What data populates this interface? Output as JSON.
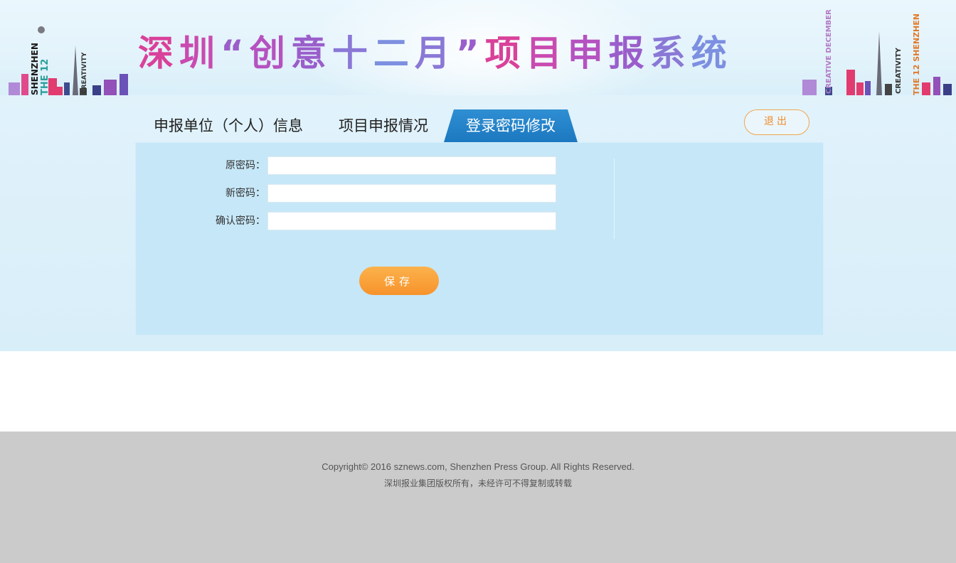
{
  "banner": {
    "title_chars": [
      "深",
      "圳",
      "“",
      "创",
      "意",
      "十",
      "二",
      "月",
      "”",
      "项",
      "目",
      "申",
      "报",
      "系",
      "统"
    ],
    "title_colors": [
      "#d9419a",
      "#c94bb0",
      "#9a5ecb",
      "#b552c0",
      "#9a5ecb",
      "#8a78d6",
      "#7c8fe0",
      "#8a78d6",
      "#9a5ecb",
      "#d9419a",
      "#c94bb0",
      "#b552c0",
      "#9a5ecb",
      "#8a78d6",
      "#7c8fe0"
    ],
    "left_vtext_1": "SHENZHEN",
    "left_vtext_2": "THE 12",
    "left_vtext_3": "CREATIVITY",
    "right_vtext_1": "CREATIVE DECEMBER",
    "right_vtext_2": "THE 12 SHENZHEN",
    "right_vtext_3": "CREATIVITY"
  },
  "tabs": {
    "unit_info": "申报单位（个人）信息",
    "project_status": "项目申报情况",
    "password_change": "登录密码修改"
  },
  "logout_label": "退出",
  "form": {
    "old_password_label": "原密码：",
    "new_password_label": "新密码：",
    "confirm_password_label": "确认密码：",
    "old_password_value": "",
    "new_password_value": "",
    "confirm_password_value": "",
    "save_label": "保存"
  },
  "footer": {
    "copyright": "Copyright© 2016 sznews.com, Shenzhen Press Group. All Rights Reserved.",
    "rights_cn": "深圳报业集团版权所有，未经许可不得复制或转载"
  },
  "colors": {
    "accent_blue": "#1c78c0",
    "button_orange": "#f7932b",
    "panel_bg": "#c6e7f7",
    "footer_bg": "#cbcbcb"
  }
}
